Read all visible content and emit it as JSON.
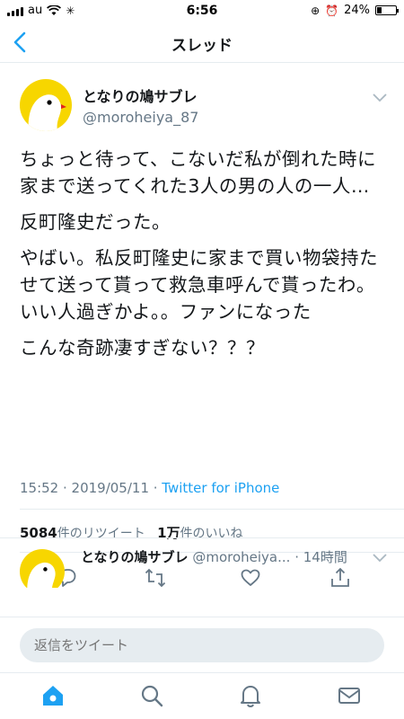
{
  "status_bar": {
    "carrier": "au",
    "time": "6:56",
    "battery": "24%",
    "battery_level": 0.24
  },
  "nav": {
    "title": "スレッド",
    "back_icon": "chevron-left-icon"
  },
  "tweet": {
    "display_name": "となりの鳩サブレ",
    "handle": "@moroheiya_87",
    "paragraphs": [
      "ちょっと待って、こないだ私が倒れた時に家まで送ってくれた3人の男の人の一人…",
      "反町隆史だった。",
      "やばい。私反町隆史に家まで買い物袋持たせて送って貰って救急車呼んで貰ったわ。いい人過ぎかよ。。ファンになった",
      "こんな奇跡凄すぎない？？？"
    ],
    "timestamp": "15:52 · 2019/05/11 · ",
    "source": "Twitter for iPhone",
    "retweets": "5084",
    "retweets_label": "件のリツイート",
    "likes": "1万",
    "likes_label": "件のいいね"
  },
  "next_tweet": {
    "display_name": "となりの鳩サブレ",
    "handle": "@moroheiya...",
    "time": "· 14時間"
  },
  "reply": {
    "placeholder": "返信をツイート"
  },
  "colors": {
    "accent": "#1da1f2",
    "avatar_bg": "#f7d600",
    "secondary_text": "#657786"
  }
}
